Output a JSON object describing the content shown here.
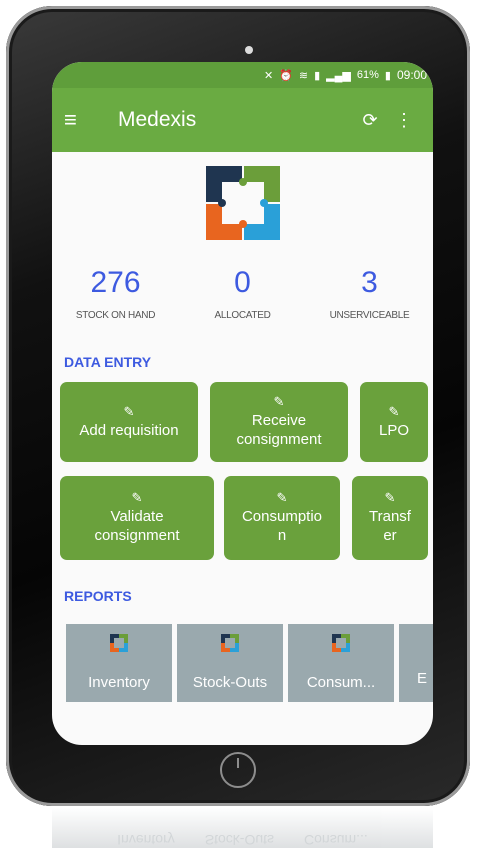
{
  "status_bar": {
    "battery": "61%",
    "time": "09:00",
    "icons": [
      "mute-icon",
      "alarm-icon",
      "wifi-icon",
      "sim-icon",
      "signal-icon",
      "battery-icon"
    ]
  },
  "app_bar": {
    "title": "Medexis",
    "menu_icon": "menu-icon",
    "sync_icon": "sync-icon",
    "overflow_icon": "more-vert-icon"
  },
  "stats": [
    {
      "value": "276",
      "label": "STOCK ON HAND"
    },
    {
      "value": "0",
      "label": "ALLOCATED"
    },
    {
      "value": "3",
      "label": "UNSERVICEABLE"
    }
  ],
  "data_entry": {
    "title": "DATA ENTRY",
    "buttons": [
      {
        "label": "Add requisition"
      },
      {
        "label": "Receive consignment"
      },
      {
        "label": "LPO"
      },
      {
        "label": "Validate consignment"
      },
      {
        "label": "Consumptio n"
      },
      {
        "label": "Transf er"
      }
    ]
  },
  "reports": {
    "title": "REPORTS",
    "tiles": [
      {
        "label": "Inventory"
      },
      {
        "label": "Stock-Outs"
      },
      {
        "label": "Consum..."
      },
      {
        "label": "E"
      }
    ]
  },
  "reflection": [
    "Inventory",
    "Stock-Outs",
    "Consum..."
  ],
  "colors": {
    "primary": "#6aab42",
    "status_bar": "#5f9e3b",
    "button": "#6aa13c",
    "accent_text": "#3d5ae0",
    "tile": "#9aa9ae"
  }
}
